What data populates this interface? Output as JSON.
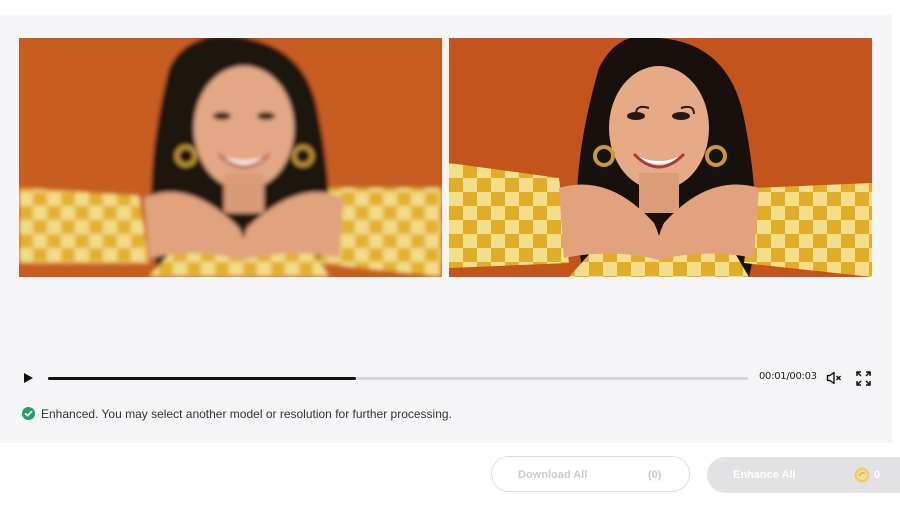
{
  "player": {
    "current_time": "00:01",
    "separator": "/",
    "duration": "00:03",
    "progress": 0.44
  },
  "status": {
    "message": "Enhanced. You may select another model or resolution for further processing.",
    "icon": "check-circle-icon",
    "color": "#22a06b"
  },
  "actions": {
    "download_all_label": "Download All",
    "download_count": "(0)",
    "enhance_all_label": "Enhance All",
    "credits": "0",
    "credit_icon": "coin-icon"
  },
  "previews": [
    {
      "name": "original-frame",
      "blurred": true
    },
    {
      "name": "enhanced-frame",
      "blurred": false
    }
  ]
}
